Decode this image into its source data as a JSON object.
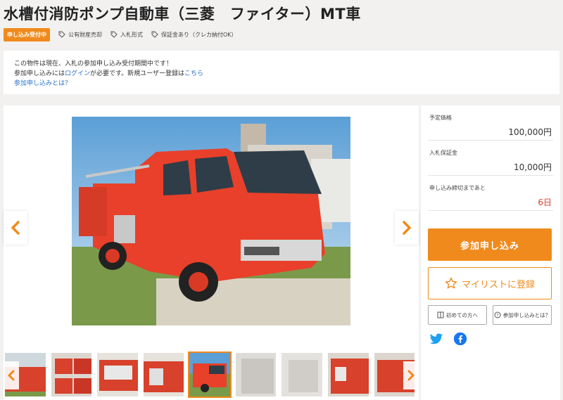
{
  "title": "水槽付消防ポンプ自動車（三菱　ファイター）MT車",
  "status_badge": "申し込み受付中",
  "tags": [
    "公有財産売却",
    "入札形式",
    "保証金あり（クレカ納付OK）"
  ],
  "notice": {
    "line1": "この物件は現在、入札の参加申し込み受付期間中です！",
    "line2_prefix": "参加申し込みには",
    "login_link": "ログイン",
    "line2_middle": "が必要です。新規ユーザー登録は",
    "register_link": "こちら",
    "help_link": "参加申し込みとは？"
  },
  "sidebar": {
    "rows": [
      {
        "label": "予定価格",
        "value": "100,000円"
      },
      {
        "label": "入札保証金",
        "value": "10,000円"
      },
      {
        "label": "申し込み締切まであと",
        "value": "6日"
      }
    ],
    "apply_button": "参加申し込み",
    "mylist_button": "マイリストに登録",
    "beginner_button": "初めての方へ",
    "what_button": "参加申し込みとは？"
  },
  "colors": {
    "accent": "#f08a1c",
    "link": "#2a72c8",
    "deadline": "#e23b2d",
    "twitter": "#1da1f2",
    "facebook": "#1877f2"
  },
  "icons": [
    "tag-icon",
    "chevron-left-icon",
    "chevron-right-icon",
    "star-icon",
    "book-icon",
    "question-icon",
    "twitter-icon",
    "facebook-icon"
  ],
  "gallery": {
    "thumb_count": 9,
    "active_thumb_index": 4
  }
}
